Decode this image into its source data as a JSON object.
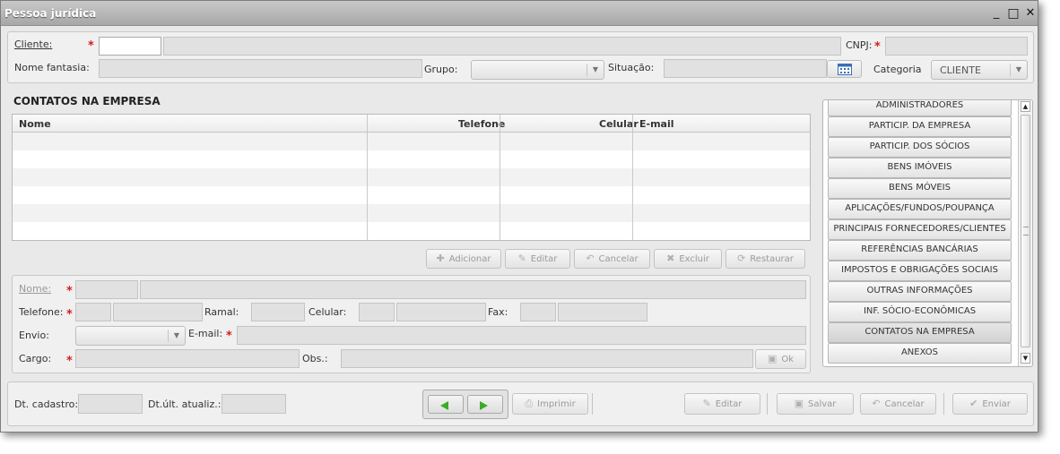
{
  "window": {
    "title": "Pessoa jurídica",
    "minimize": "_",
    "maximize": "□",
    "close": "✕"
  },
  "header": {
    "cliente_label": "Cliente:",
    "cnpj_label": "CNPJ:",
    "nome_fantasia_label": "Nome fantasia:",
    "grupo_label": "Grupo:",
    "situacao_label": "Situação:",
    "categoria_label": "Categoria",
    "categoria_value": "CLIENTE"
  },
  "contatos": {
    "title": "CONTATOS NA EMPRESA",
    "columns": [
      "Nome",
      "Telefone",
      "Celular",
      "E-mail"
    ],
    "actions": {
      "adicionar": "Adicionar",
      "editar": "Editar",
      "cancelar": "Cancelar",
      "excluir": "Excluir",
      "restaurar": "Restaurar"
    }
  },
  "form": {
    "nome_label": "Nome:",
    "telefone_label": "Telefone:",
    "ramal_label": "Ramal:",
    "celular_label": "Celular:",
    "fax_label": "Fax:",
    "envio_label": "Envio:",
    "email_label": "E-mail:",
    "cargo_label": "Cargo:",
    "obs_label": "Obs.:",
    "ok_label": "Ok"
  },
  "sidebar": {
    "items": [
      "ADMINISTRADORES",
      "PARTICIP. DA EMPRESA",
      "PARTICIP. DOS SÓCIOS",
      "BENS IMÓVEIS",
      "BENS MÓVEIS",
      "APLICAÇÕES/FUNDOS/POUPANÇA",
      "PRINCIPAIS FORNECEDORES/CLIENTES",
      "REFERÊNCIAS BANCÁRIAS",
      "IMPOSTOS E OBRIGAÇÕES SOCIAIS",
      "OUTRAS INFORMAÇÕES",
      "INF. SÓCIO-ECONÔMICAS",
      "CONTATOS NA EMPRESA",
      "ANEXOS"
    ],
    "active_index": 11
  },
  "footer": {
    "dt_cadastro_label": "Dt. cadastro:",
    "dt_atualiz_label": "Dt.últ. atualiz.:",
    "imprimir": "Imprimir",
    "editar": "Editar",
    "salvar": "Salvar",
    "cancelar": "Cancelar",
    "enviar": "Enviar"
  },
  "colors": {
    "nav_arrow": "#3caa2a",
    "required": "#d32020"
  }
}
